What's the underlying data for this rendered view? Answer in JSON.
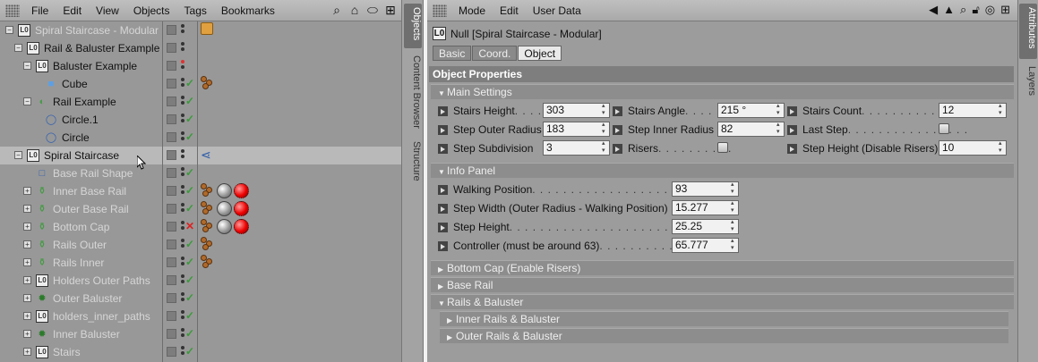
{
  "object_manager": {
    "menu": [
      "File",
      "Edit",
      "View",
      "Objects",
      "Tags",
      "Bookmarks"
    ],
    "rows": [
      {
        "label": "Spiral Staircase - Modular",
        "indent": 0,
        "icon": "null",
        "dim": true,
        "check": "none",
        "tags": [
          "orange"
        ],
        "toggle": "-"
      },
      {
        "label": "Rail & Baluster Example",
        "indent": 1,
        "icon": "null",
        "dim": false,
        "check": "none",
        "tags": [],
        "toggle": "-"
      },
      {
        "label": "Baluster Example",
        "indent": 2,
        "icon": "null",
        "dim": false,
        "check": "none",
        "tags": [],
        "toggle": "-",
        "reddot": true
      },
      {
        "label": "Cube",
        "indent": 3,
        "icon": "cube",
        "dim": false,
        "check": "ok",
        "tags": [
          "bronze"
        ],
        "toggle": ""
      },
      {
        "label": "Rail Example",
        "indent": 2,
        "icon": "sweep",
        "dim": false,
        "check": "ok",
        "tags": [],
        "toggle": "-"
      },
      {
        "label": "Circle.1",
        "indent": 3,
        "icon": "circle",
        "dim": false,
        "check": "ok",
        "tags": [],
        "toggle": ""
      },
      {
        "label": "Circle",
        "indent": 3,
        "icon": "circle",
        "dim": false,
        "check": "ok",
        "tags": [],
        "toggle": ""
      },
      {
        "label": "Spiral Staircase",
        "indent": 1,
        "icon": "null",
        "dim": false,
        "check": "none",
        "tags": [
          "net"
        ],
        "toggle": "-",
        "selected": true
      },
      {
        "label": "Base Rail Shape",
        "indent": 2,
        "icon": "square",
        "dim": true,
        "check": "ok",
        "tags": [],
        "toggle": ""
      },
      {
        "label": "Inner Base Rail",
        "indent": 2,
        "icon": "bottle",
        "dim": true,
        "check": "ok",
        "tags": [
          "bronze",
          "sphere",
          "red"
        ],
        "toggle": "+"
      },
      {
        "label": "Outer Base Rail",
        "indent": 2,
        "icon": "bottle",
        "dim": true,
        "check": "ok",
        "tags": [
          "bronze",
          "sphere",
          "red"
        ],
        "toggle": "+"
      },
      {
        "label": "Bottom Cap",
        "indent": 2,
        "icon": "bottle",
        "dim": true,
        "check": "x",
        "tags": [
          "bronze",
          "sphere",
          "red"
        ],
        "toggle": "+"
      },
      {
        "label": "Rails Outer",
        "indent": 2,
        "icon": "bottle",
        "dim": true,
        "check": "ok",
        "tags": [
          "bronze"
        ],
        "toggle": "+"
      },
      {
        "label": "Rails Inner",
        "indent": 2,
        "icon": "bottle",
        "dim": true,
        "check": "ok",
        "tags": [
          "bronze"
        ],
        "toggle": "+"
      },
      {
        "label": "Holders Outer Paths",
        "indent": 2,
        "icon": "null",
        "dim": true,
        "check": "ok",
        "tags": [],
        "toggle": "+"
      },
      {
        "label": "Outer Baluster",
        "indent": 2,
        "icon": "gear",
        "dim": true,
        "check": "ok",
        "tags": [],
        "toggle": "+"
      },
      {
        "label": "holders_inner_paths",
        "indent": 2,
        "icon": "null",
        "dim": true,
        "check": "ok",
        "tags": [],
        "toggle": "+"
      },
      {
        "label": "Inner Baluster",
        "indent": 2,
        "icon": "gear",
        "dim": true,
        "check": "ok",
        "tags": [],
        "toggle": "+"
      },
      {
        "label": "Stairs",
        "indent": 2,
        "icon": "null",
        "dim": true,
        "check": "ok",
        "tags": [],
        "toggle": "+"
      }
    ]
  },
  "left_tabs": [
    "Objects",
    "Content Browser",
    "Structure"
  ],
  "right_tabs": [
    "Attributes",
    "Layers"
  ],
  "attributes": {
    "menu": [
      "Mode",
      "Edit",
      "User Data"
    ],
    "object_title": "Null [Spiral Staircase - Modular]",
    "tabs": [
      "Basic",
      "Coord.",
      "Object"
    ],
    "active_tab": "Object",
    "section_title": "Object Properties",
    "main_settings": "Main Settings",
    "info_panel": "Info Panel",
    "props": {
      "stairs_height": {
        "label": "Stairs Height",
        "dots": " . . . .",
        "value": "303"
      },
      "stairs_angle": {
        "label": "Stairs Angle",
        "dots": " . . . .",
        "value": "215 °"
      },
      "stairs_count": {
        "label": "Stairs Count",
        "dots": " . . . . . . . . . . . . .",
        "value": "12"
      },
      "step_outer_radius": {
        "label": "Step Outer Radius",
        "value": "183"
      },
      "step_inner_radius": {
        "label": "Step Inner Radius",
        "value": "82"
      },
      "last_step": {
        "label": "Last Step",
        "dots": " . . . . . . . . . . . . . . . ."
      },
      "step_subdivision": {
        "label": "Step Subdivision",
        "value": "3"
      },
      "risers": {
        "label": "Risers",
        "dots": " . . . . . . . . . ."
      },
      "step_height_disable": {
        "label": "Step Height (Disable Risers)",
        "value": "10"
      },
      "walking_position": {
        "label": "Walking Position",
        "dots": " . . . . . . . . . . . . . . . . . . . . . . . .",
        "value": "93"
      },
      "step_width": {
        "label": "Step Width (Outer Radius - Walking Position)",
        "value": "15.277"
      },
      "step_height": {
        "label": "Step Height",
        "dots": " . . . . . . . . . . . . . . . . . . . . . . . . . . . .",
        "value": "25.25"
      },
      "controller": {
        "label": "Controller (must be around 63)",
        "dots": " . . . . . . . . . . .",
        "value": "65.777"
      }
    },
    "groups": {
      "bottom_cap": "Bottom Cap (Enable Risers)",
      "base_rail": "Base Rail",
      "rails_baluster": "Rails & Baluster",
      "inner_rails": "Inner Rails & Baluster",
      "outer_rails": "Outer Rails & Baluster"
    }
  }
}
